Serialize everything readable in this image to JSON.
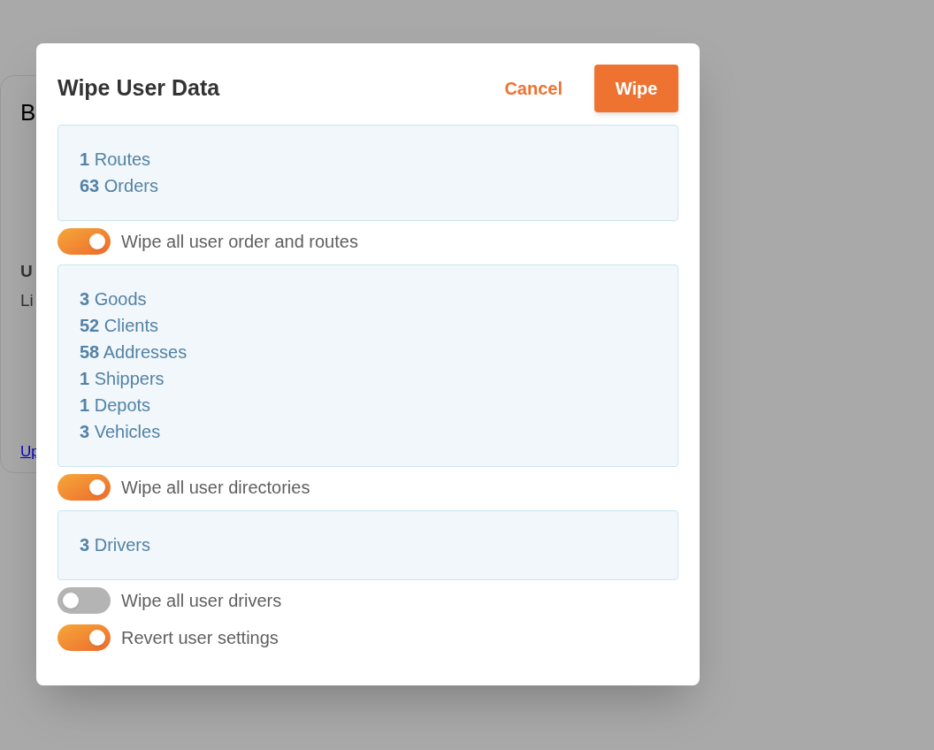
{
  "background_card": {
    "title": "B",
    "label": "U",
    "value": "Li",
    "link": "Up"
  },
  "dialog": {
    "title": "Wipe User Data",
    "cancel": "Cancel",
    "confirm": "Wipe",
    "sections": [
      {
        "kind": "summary",
        "items": [
          {
            "count": "1",
            "label": "Routes"
          },
          {
            "count": "63",
            "label": "Orders"
          }
        ]
      },
      {
        "kind": "toggle",
        "label": "Wipe all user order and routes",
        "on": true
      },
      {
        "kind": "summary",
        "items": [
          {
            "count": "3",
            "label": "Goods"
          },
          {
            "count": "52",
            "label": "Clients"
          },
          {
            "count": "58",
            "label": "Addresses"
          },
          {
            "count": "1",
            "label": "Shippers"
          },
          {
            "count": "1",
            "label": "Depots"
          },
          {
            "count": "3",
            "label": "Vehicles"
          }
        ]
      },
      {
        "kind": "toggle",
        "label": "Wipe all user directories",
        "on": true
      },
      {
        "kind": "summary",
        "items": [
          {
            "count": "3",
            "label": "Drivers"
          }
        ]
      },
      {
        "kind": "toggle",
        "label": "Wipe all user drivers",
        "on": false
      },
      {
        "kind": "toggle",
        "label": "Revert user settings",
        "on": true
      }
    ]
  }
}
